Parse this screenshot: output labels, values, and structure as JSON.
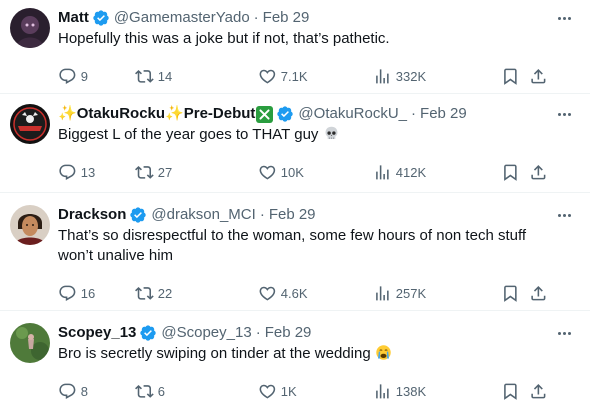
{
  "colors": {
    "verified_blue": "#1d9bf0",
    "secondary_text": "#536471",
    "primary_text": "#0f1419",
    "divider": "#eff3f4"
  },
  "tweets": [
    {
      "display_name": "Matt",
      "handle": "@GamemasterYado",
      "separator": "·",
      "date": "Feb 29",
      "text": "Hopefully this was a joke but if not, that’s pathetic.",
      "replies": "9",
      "retweets": "14",
      "likes": "7.1K",
      "views": "332K",
      "avatar_icon": "dark-hooded-figure-avatar"
    },
    {
      "display_name_prefix": "✨",
      "display_name": "OtakuRocku",
      "display_name_mid": "✨",
      "display_name_suffix": "Pre-Debut",
      "handle": "@OtakuRockU_",
      "separator": "·",
      "date": "Feb 29",
      "text": "Biggest L of the year goes to THAT guy",
      "text_emoji": "skull-emoji",
      "replies": "13",
      "retweets": "27",
      "likes": "10K",
      "views": "412K",
      "avatar_icon": "otaku-rocku-logo-avatar"
    },
    {
      "display_name": "Drackson",
      "handle": "@drakson_MCI",
      "separator": "·",
      "date": "Feb 29",
      "text": "That’s so disrespectful to the woman, some few hours of non tech stuff won’t unalive him",
      "replies": "16",
      "retweets": "22",
      "likes": "4.6K",
      "views": "257K",
      "avatar_icon": "person-portrait-avatar"
    },
    {
      "display_name": "Scopey_13",
      "handle": "@Scopey_13",
      "separator": "·",
      "date": "Feb 29",
      "text": "Bro is secretly swiping on tinder at the wedding",
      "text_emoji": "crying-face-emoji",
      "replies": "8",
      "retweets": "6",
      "likes": "1K",
      "views": "138K",
      "avatar_icon": "green-field-avatar"
    }
  ]
}
